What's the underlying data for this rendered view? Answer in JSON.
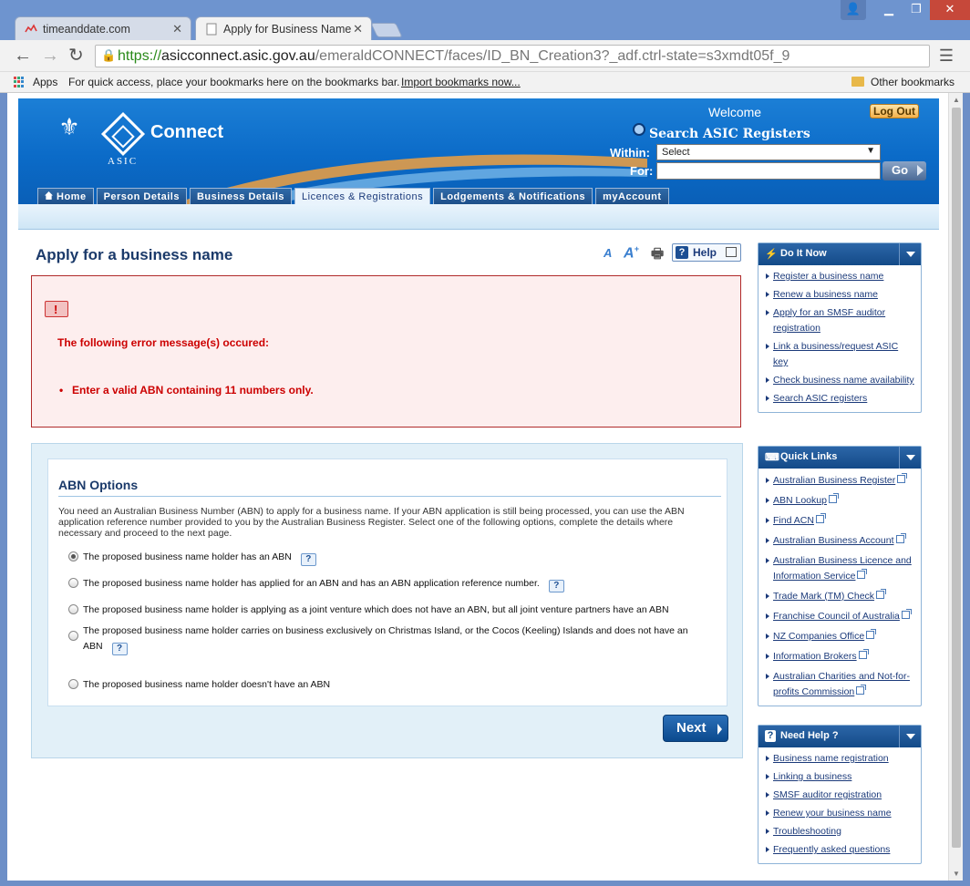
{
  "browser": {
    "tabs": [
      {
        "title": "timeanddate.com"
      },
      {
        "title": "Apply for Business Name"
      }
    ],
    "url": {
      "scheme": "https://",
      "host": "asicconnect.asic.gov.au",
      "path": "/emeraldCONNECT/faces/ID_BN_Creation3?_adf.ctrl-state=s3xmdt05f_9"
    },
    "bookmarks": {
      "apps": "Apps",
      "hint": "For quick access, place your bookmarks here on the bookmarks bar.",
      "import": "Import bookmarks now...",
      "other": "Other bookmarks"
    }
  },
  "header": {
    "brand": "Connect",
    "brand_sub": "ASIC",
    "welcome": "Welcome",
    "logout": "Log Out",
    "search_title": "Search ASIC Registers",
    "within_label": "Within:",
    "within_value": "Select",
    "for_label": "For:",
    "go": "Go",
    "nav": [
      {
        "label": "Home"
      },
      {
        "label": "Person Details"
      },
      {
        "label": "Business Details"
      },
      {
        "label": "Licences & Registrations"
      },
      {
        "label": "Lodgements & Notifications"
      },
      {
        "label": "myAccount"
      }
    ]
  },
  "main": {
    "title": "Apply for a business name",
    "help": "Help",
    "error": {
      "title": "The following error message(s) occured:",
      "item": "Enter a valid ABN containing 11 numbers only."
    },
    "abn": {
      "heading": "ABN Options",
      "description": "You need an Australian Business Number (ABN) to apply for a business name. If your ABN application is still being processed, you can use the ABN application reference number provided to you by the Australian Business Register. Select one of the following options, complete the details where necessary and proceed to the next page.",
      "options": [
        {
          "label": "The proposed business name holder has an ABN",
          "selected": true
        },
        {
          "label": "The proposed business name holder has applied for an ABN and has an ABN application reference number.",
          "selected": false
        },
        {
          "label": "The proposed business name holder is applying as a joint venture which does not have an ABN, but all joint venture partners have an ABN",
          "selected": false
        },
        {
          "label": "The proposed business name holder carries on business exclusively on Christmas Island, or the Cocos (Keeling) Islands and does not have an ABN",
          "selected": false
        },
        {
          "label": "The proposed business name holder doesn't have an ABN",
          "selected": false
        }
      ],
      "next": "Next"
    }
  },
  "sidebar": {
    "do_it_now": {
      "title": "Do It Now",
      "links": [
        "Register a business name",
        "Renew a business name",
        "Apply for an SMSF auditor registration",
        "Link a business/request ASIC key",
        "Check business name availability",
        "Search ASIC registers"
      ]
    },
    "quick_links": {
      "title": "Quick Links",
      "links": [
        "Australian Business Register",
        "ABN Lookup",
        "Find ACN",
        "Australian Business Account",
        "Australian Business Licence and Information Service",
        "Trade Mark (TM) Check",
        "Franchise Council of Australia",
        "NZ Companies Office",
        "Information Brokers",
        "Australian Charities and Not-for-profits Commission"
      ]
    },
    "need_help": {
      "title": "Need Help ?",
      "links": [
        "Business name registration",
        "Linking a business",
        "SMSF auditor registration",
        "Renew your business name",
        "Troubleshooting",
        "Frequently asked questions"
      ]
    }
  }
}
